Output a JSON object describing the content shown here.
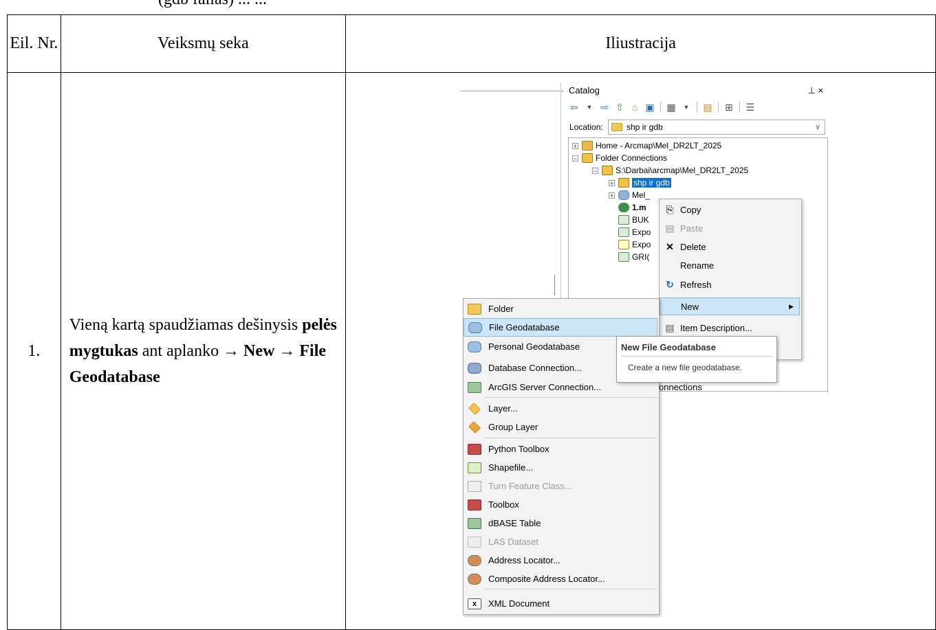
{
  "cut_text": "(gdb failas) ... ...",
  "table": {
    "header": {
      "col1": "Eil. Nr.",
      "col2": "Veiksmų seka",
      "col3": "Iliustracija"
    },
    "row": {
      "num": "1.",
      "step_parts": [
        "Vieną kartą spaudžiamas dešinysis ",
        "pelės mygtukas",
        " ant aplanko → ",
        "New → File Geodatabase"
      ]
    }
  },
  "catalog": {
    "title": "Catalog",
    "pin": "⊥ ×",
    "location_label": "Location:",
    "location_value": "shp ir gdb",
    "tree": [
      {
        "label": "Home - Arcmap\\Mel_DR2LT_2025",
        "exp": "+"
      },
      {
        "label": "Folder Connections",
        "exp": "−"
      },
      {
        "label": "S:\\Darbai\\arcmap\\Mel_DR2LT_2025",
        "exp": "−"
      },
      {
        "label": "shp ir gdb",
        "exp": "+"
      },
      {
        "label": "Mel_",
        "exp": "+"
      },
      {
        "label": "1.m",
        "exp": ""
      },
      {
        "label": "BUK",
        "exp": ""
      },
      {
        "label": "Expo",
        "exp": ""
      },
      {
        "label": "Expo",
        "exp": ""
      },
      {
        "label": "GRI(",
        "exp": ""
      }
    ]
  },
  "context_menu": {
    "items": [
      {
        "label": "Copy",
        "icon": "copy-icon",
        "glyph": "⎘"
      },
      {
        "label": "Paste",
        "icon": "paste-icon",
        "glyph": "📋"
      },
      {
        "label": "Delete",
        "icon": "delete-icon",
        "glyph": "✕"
      },
      {
        "label": "Rename",
        "icon": "",
        "glyph": ""
      },
      {
        "label": "Refresh",
        "icon": "refresh-icon",
        "glyph": "↻"
      },
      {
        "label": "New",
        "icon": "",
        "glyph": ""
      },
      {
        "label": "Item Description...",
        "icon": "item-description-icon",
        "glyph": "🗎"
      }
    ]
  },
  "new_submenu": {
    "items": [
      "Folder",
      "File Geodatabase",
      "Personal Geodatabase",
      "Database Connection...",
      "ArcGIS Server Connection...",
      "Layer...",
      "Group Layer",
      "Python Toolbox",
      "Shapefile...",
      "Turn Feature Class...",
      "Toolbox",
      "dBASE Table",
      "LAS Dataset",
      "Address Locator...",
      "Composite Address Locator...",
      "XML Document"
    ]
  },
  "tooltip": {
    "title": "New File Geodatabase",
    "text": "Create a new file geodatabase."
  },
  "peek_text": "onnections",
  "colors": {
    "selection": "#0a6fd6",
    "menu_hover": "#cde6f7",
    "menu_bg": "#f3f3f3"
  }
}
